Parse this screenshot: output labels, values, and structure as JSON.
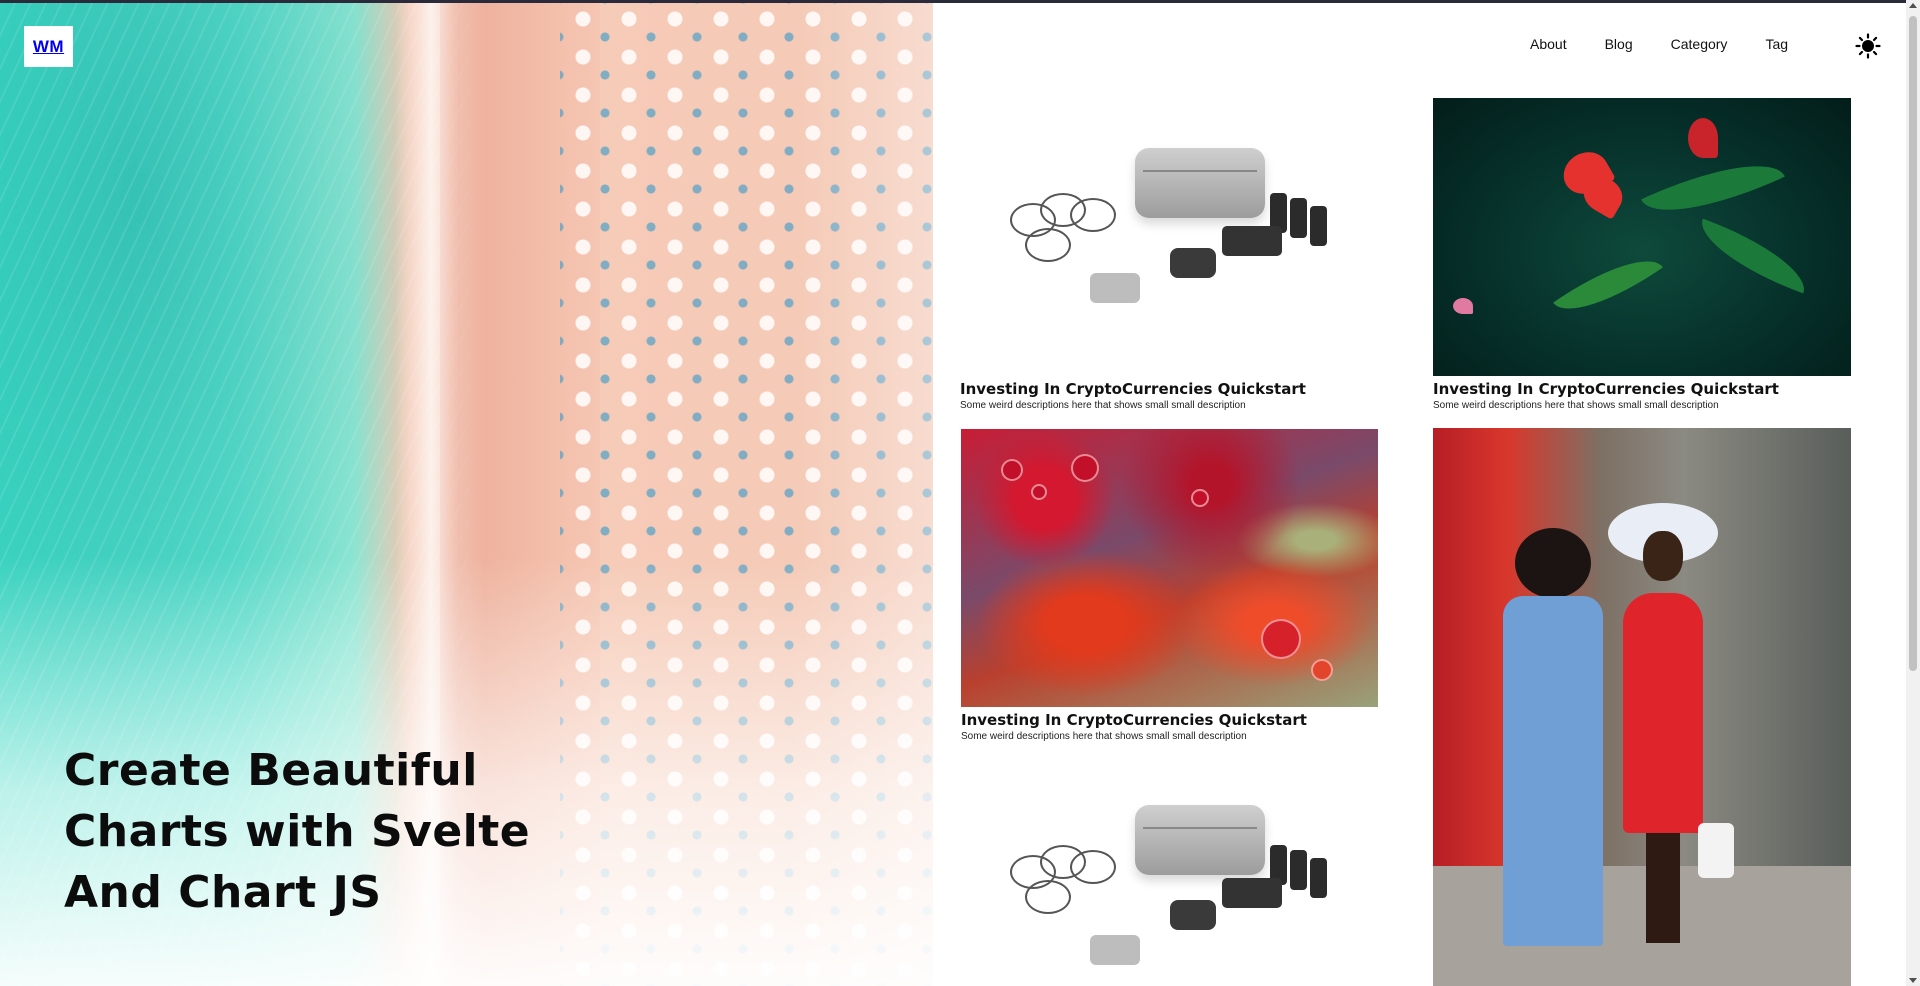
{
  "site": {
    "logo_text": "WM"
  },
  "nav": {
    "items": [
      {
        "label": "About"
      },
      {
        "label": "Blog"
      },
      {
        "label": "Category"
      },
      {
        "label": "Tag"
      }
    ],
    "theme_toggle_icon": "sun-icon"
  },
  "hero": {
    "title_lines": [
      "Create Beautiful",
      "Charts with Svelte",
      "And Chart JS"
    ],
    "image": "aerial-beach-image"
  },
  "posts": [
    {
      "title": "Investing In CryptoCurrencies Quickstart",
      "description": "Some weird descriptions here that shows small small description",
      "image": "drone-kit-image"
    },
    {
      "title": "Investing In CryptoCurrencies Quickstart",
      "description": "Some weird descriptions here that shows small small description",
      "image": "red-flower-image"
    },
    {
      "title": "Investing In CryptoCurrencies Quickstart",
      "description": "Some weird descriptions here that shows small small description",
      "image": "acrylic-pour-image"
    },
    {
      "title": "",
      "description": "",
      "image": "couple-street-image"
    },
    {
      "title": "",
      "description": "",
      "image": "drone-kit-image"
    }
  ],
  "colors": {
    "accent": "#111111",
    "sea": "#3fd9c4",
    "sand": "#f4c9b6"
  }
}
